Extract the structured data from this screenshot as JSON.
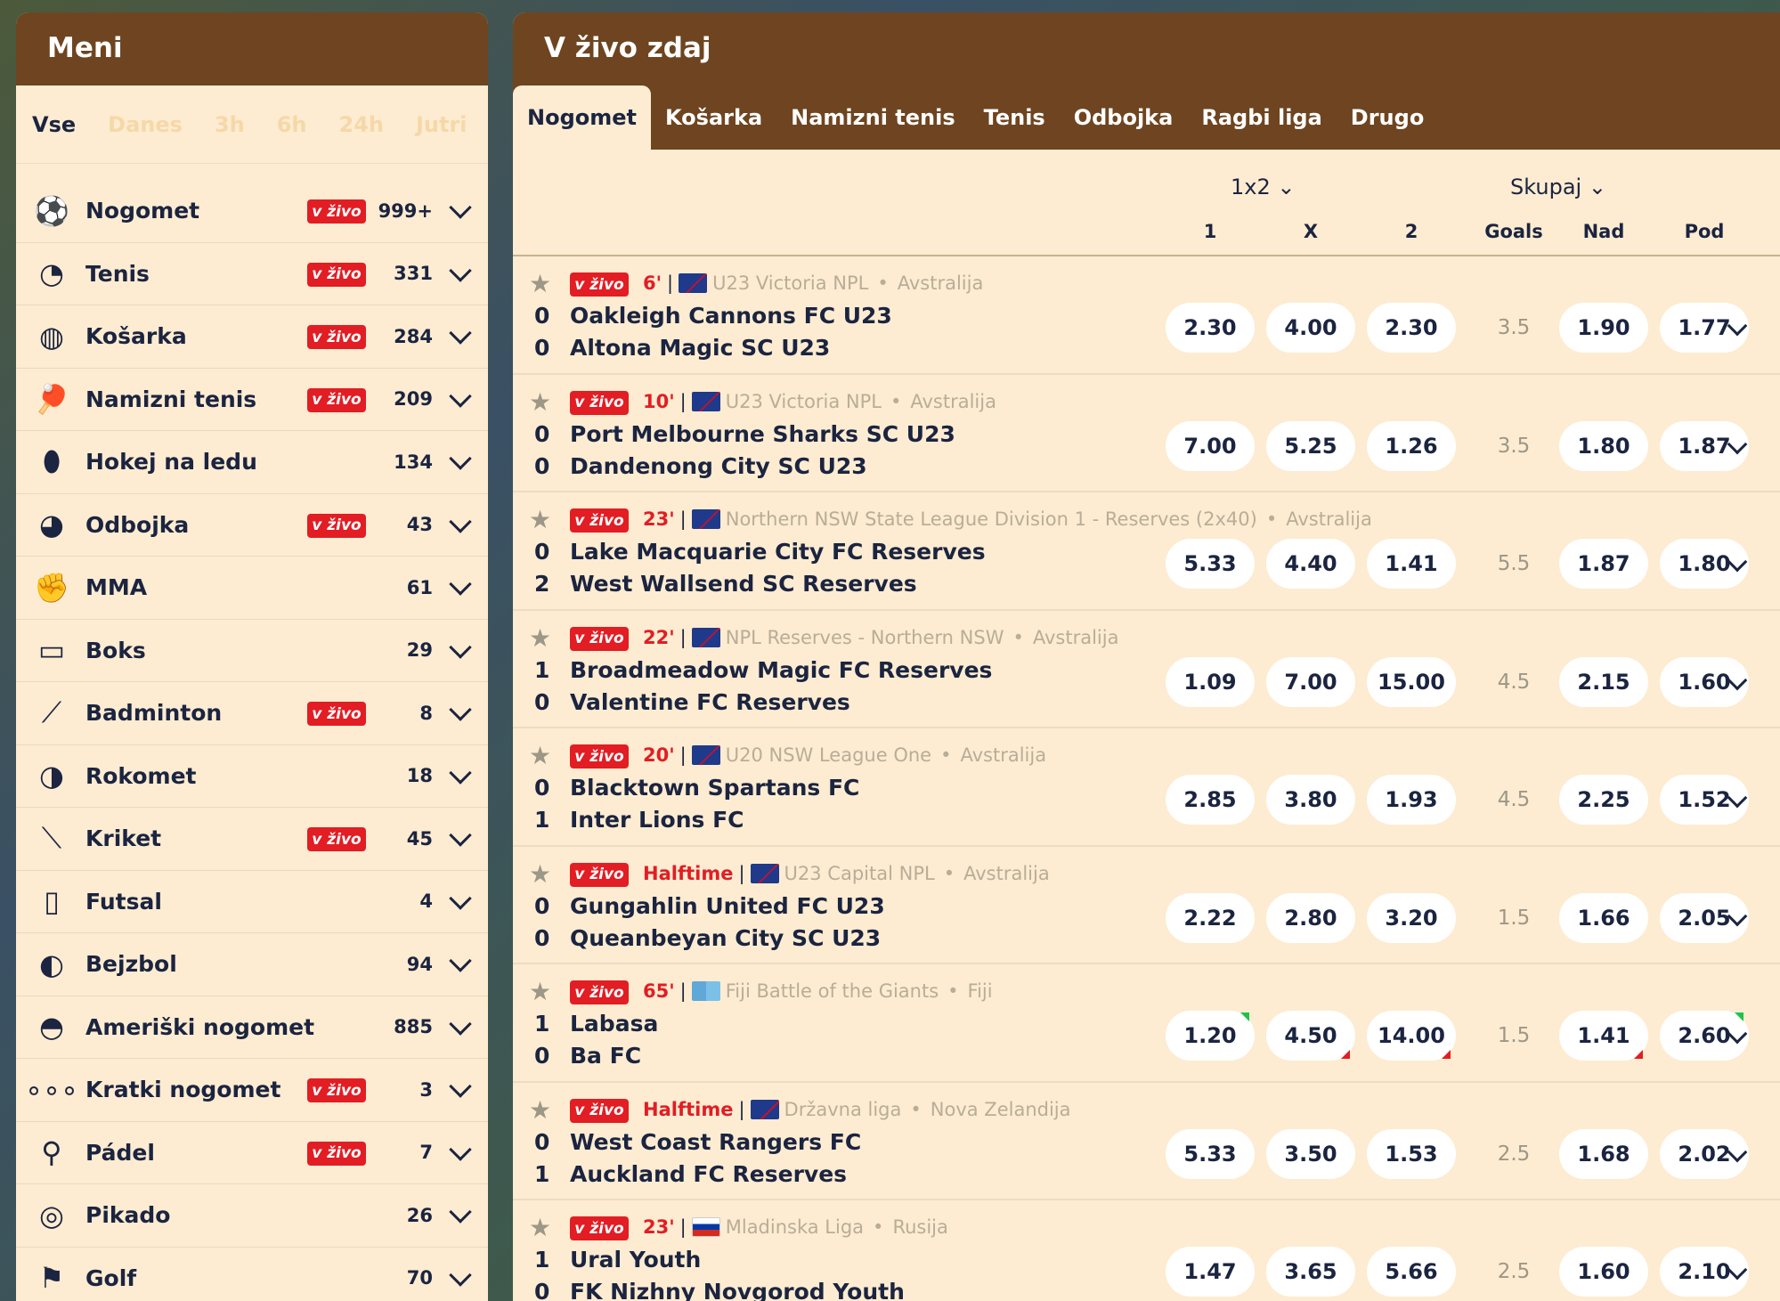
{
  "menu": {
    "title": "Meni",
    "time_tabs": [
      "Vse",
      "Danes",
      "3h",
      "6h",
      "24h",
      "Jutri"
    ],
    "sports": [
      {
        "name": "Nogomet",
        "live": true,
        "count": "999+",
        "icon": "soccer-ball-icon"
      },
      {
        "name": "Tenis",
        "live": true,
        "count": "331",
        "icon": "tennis-ball-icon"
      },
      {
        "name": "Košarka",
        "live": true,
        "count": "284",
        "icon": "basketball-icon"
      },
      {
        "name": "Namizni tenis",
        "live": true,
        "count": "209",
        "icon": "table-tennis-icon"
      },
      {
        "name": "Hokej na ledu",
        "live": false,
        "count": "134",
        "icon": "hockey-puck-icon"
      },
      {
        "name": "Odbojka",
        "live": true,
        "count": "43",
        "icon": "volleyball-icon"
      },
      {
        "name": "MMA",
        "live": false,
        "count": "61",
        "icon": "fist-glove-icon"
      },
      {
        "name": "Boks",
        "live": false,
        "count": "29",
        "icon": "boxing-glove-icon"
      },
      {
        "name": "Badminton",
        "live": true,
        "count": "8",
        "icon": "shuttlecock-icon"
      },
      {
        "name": "Rokomet",
        "live": false,
        "count": "18",
        "icon": "handball-icon"
      },
      {
        "name": "Kriket",
        "live": true,
        "count": "45",
        "icon": "cricket-bat-icon"
      },
      {
        "name": "Futsal",
        "live": false,
        "count": "4",
        "icon": "futsal-pitch-icon"
      },
      {
        "name": "Bejzbol",
        "live": false,
        "count": "94",
        "icon": "baseball-icon"
      },
      {
        "name": "Ameriški nogomet",
        "live": false,
        "count": "885",
        "icon": "football-helmet-icon"
      },
      {
        "name": "Kratki nogomet",
        "live": true,
        "count": "3",
        "icon": "short-football-icon"
      },
      {
        "name": "Pádel",
        "live": true,
        "count": "7",
        "icon": "padel-racket-icon"
      },
      {
        "name": "Pikado",
        "live": false,
        "count": "26",
        "icon": "dartboard-icon"
      },
      {
        "name": "Golf",
        "live": false,
        "count": "70",
        "icon": "golf-flag-icon"
      }
    ],
    "live_label": "v živo"
  },
  "live": {
    "title": "V živo zdaj",
    "tabs": [
      "Nogomet",
      "Košarka",
      "Namizni tenis",
      "Tenis",
      "Odbojka",
      "Ragbi liga",
      "Drugo"
    ],
    "market_1": "1x2",
    "market_2": "Skupaj",
    "col_1": "1",
    "col_x": "X",
    "col_2": "2",
    "col_goals": "Goals",
    "col_over": "Nad",
    "col_under": "Pod",
    "live_label": "v živo",
    "matches": [
      {
        "time": "6'",
        "flag": "au",
        "league": "U23 Victoria NPL",
        "country": "Avstralija",
        "home": "Oakleigh Cannons FC U23",
        "away": "Altona Magic SC U23",
        "hs": "0",
        "as": "0",
        "o1": "2.30",
        "ox": "4.00",
        "o2": "2.30",
        "goals": "3.5",
        "over": "1.90",
        "under": "1.77"
      },
      {
        "time": "10'",
        "flag": "au",
        "league": "U23 Victoria NPL",
        "country": "Avstralija",
        "home": "Port Melbourne Sharks SC U23",
        "away": "Dandenong City SC U23",
        "hs": "0",
        "as": "0",
        "o1": "7.00",
        "ox": "5.25",
        "o2": "1.26",
        "goals": "3.5",
        "over": "1.80",
        "under": "1.87"
      },
      {
        "time": "23'",
        "flag": "au",
        "league": "Northern NSW State League Division 1 - Reserves (2x40)",
        "country": "Avstralija",
        "home": "Lake Macquarie City FC Reserves",
        "away": "West Wallsend SC Reserves",
        "hs": "0",
        "as": "2",
        "o1": "5.33",
        "ox": "4.40",
        "o2": "1.41",
        "goals": "5.5",
        "over": "1.87",
        "under": "1.80"
      },
      {
        "time": "22'",
        "flag": "au",
        "league": "NPL Reserves - Northern NSW",
        "country": "Avstralija",
        "home": "Broadmeadow Magic FC Reserves",
        "away": "Valentine FC Reserves",
        "hs": "1",
        "as": "0",
        "o1": "1.09",
        "ox": "7.00",
        "o2": "15.00",
        "goals": "4.5",
        "over": "2.15",
        "under": "1.60"
      },
      {
        "time": "20'",
        "flag": "au",
        "league": "U20 NSW League One",
        "country": "Avstralija",
        "home": "Blacktown Spartans FC",
        "away": "Inter Lions FC",
        "hs": "0",
        "as": "1",
        "o1": "2.85",
        "ox": "3.80",
        "o2": "1.93",
        "goals": "4.5",
        "over": "2.25",
        "under": "1.52"
      },
      {
        "time": "Halftime",
        "flag": "au",
        "league": "U23 Capital NPL",
        "country": "Avstralija",
        "home": "Gungahlin United FC U23",
        "away": "Queanbeyan City SC U23",
        "hs": "0",
        "as": "0",
        "o1": "2.22",
        "ox": "2.80",
        "o2": "3.20",
        "goals": "1.5",
        "over": "1.66",
        "under": "2.05"
      },
      {
        "time": "65'",
        "flag": "fj",
        "league": "Fiji Battle of the Giants",
        "country": "Fiji",
        "home": "Labasa",
        "away": "Ba FC",
        "hs": "1",
        "as": "0",
        "o1": "1.20",
        "ox": "4.50",
        "o2": "14.00",
        "goals": "1.5",
        "over": "1.41",
        "under": "2.60"
      },
      {
        "time": "Halftime",
        "flag": "nz",
        "league": "Državna liga",
        "country": "Nova Zelandija",
        "home": "West Coast Rangers FC",
        "away": "Auckland FC Reserves",
        "hs": "0",
        "as": "1",
        "o1": "5.33",
        "ox": "3.50",
        "o2": "1.53",
        "goals": "2.5",
        "over": "1.68",
        "under": "2.02"
      },
      {
        "time": "23'",
        "flag": "ru",
        "league": "Mladinska Liga",
        "country": "Rusija",
        "home": "Ural Youth",
        "away": "FK Nizhny Novgorod Youth",
        "hs": "1",
        "as": "0",
        "o1": "1.47",
        "ox": "3.65",
        "o2": "5.66",
        "goals": "2.5",
        "over": "1.60",
        "under": "2.10"
      }
    ]
  },
  "colors": {
    "accent": "#6e4520",
    "live_red": "#e21d24",
    "panel": "#fdecd1",
    "navy": "#1b2440"
  }
}
